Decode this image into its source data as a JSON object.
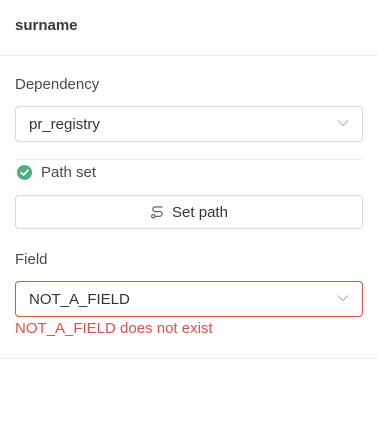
{
  "header": {
    "title": "surname"
  },
  "dependency": {
    "label": "Dependency",
    "value": "pr_registry",
    "icon": "chevron-down-icon"
  },
  "path": {
    "status_text": "Path set",
    "status_icon": "check-circle-icon",
    "status_color": "#4caf7d",
    "button_label": "Set path",
    "button_icon": "route-icon"
  },
  "field": {
    "label": "Field",
    "value": "NOT_A_FIELD",
    "error": "NOT_A_FIELD does not exist",
    "error_color": "#d9534f"
  }
}
